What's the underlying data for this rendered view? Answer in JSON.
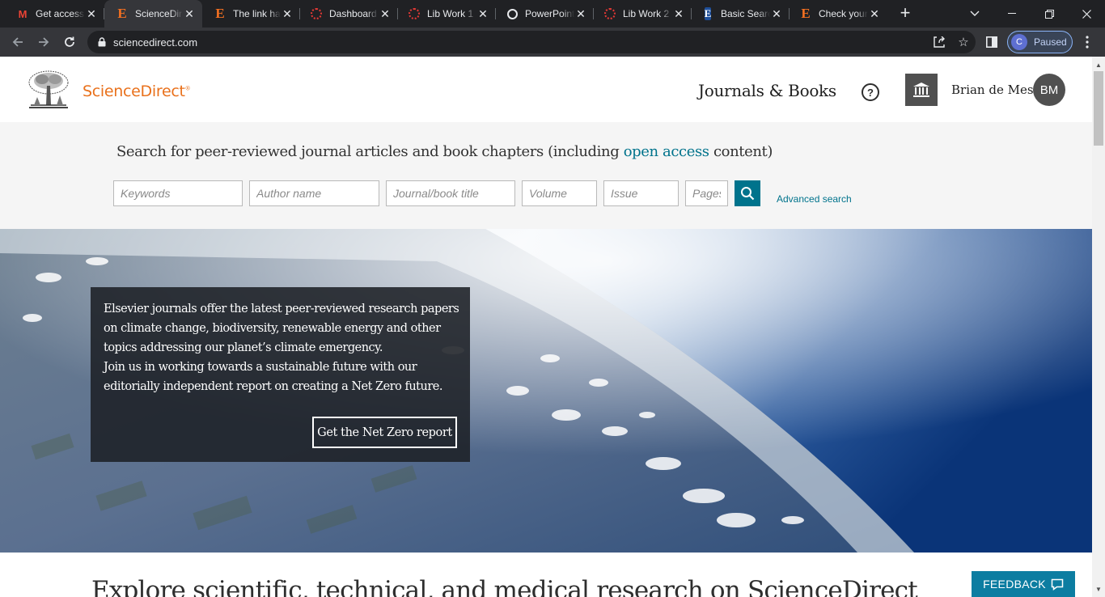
{
  "browser": {
    "tabs": [
      {
        "title": "Get access",
        "icon": "gmail-icon"
      },
      {
        "title": "ScienceDirect",
        "icon": "elsevier-icon"
      },
      {
        "title": "The link has",
        "icon": "elsevier-icon"
      },
      {
        "title": "Dashboard",
        "icon": "loading-ring-icon"
      },
      {
        "title": "Lib Work 1",
        "icon": "loading-ring-icon"
      },
      {
        "title": "PowerPoint",
        "icon": "globe-icon"
      },
      {
        "title": "Lib Work 2",
        "icon": "loading-ring-icon"
      },
      {
        "title": "Basic Search",
        "icon": "e-blue-icon"
      },
      {
        "title": "Check your",
        "icon": "elsevier-icon"
      }
    ],
    "url": "sciencedirect.com",
    "profile": {
      "initial": "C",
      "status": "Paused"
    }
  },
  "header": {
    "logo_text": "ScienceDirect",
    "journals_books": "Journals & Books",
    "user_name": "Brian de Mesa",
    "user_initials": "BM"
  },
  "search": {
    "prompt_before": "Search for peer-reviewed journal articles and book chapters (including ",
    "prompt_link": "open access",
    "prompt_after": " content)",
    "placeholders": {
      "keywords": "Keywords",
      "author": "Author name",
      "journal": "Journal/book title",
      "volume": "Volume",
      "issue": "Issue",
      "pages": "Pages"
    },
    "advanced": "Advanced search"
  },
  "hero": {
    "text1": "Elsevier journals offer the latest peer-reviewed research papers on climate change, biodiversity, renewable energy and other topics addressing our planet’s climate emergency.",
    "text2": "Join us in working towards a sustainable future with our editorially independent report on creating a Net Zero future.",
    "button": "Get the Net Zero report"
  },
  "explore_heading": "Explore scientific, technical, and medical research on ScienceDirect",
  "feedback": "FEEDBACK",
  "colors": {
    "brand_orange": "#e9711c",
    "teal": "#00738c",
    "feedback": "#0c7da1"
  }
}
